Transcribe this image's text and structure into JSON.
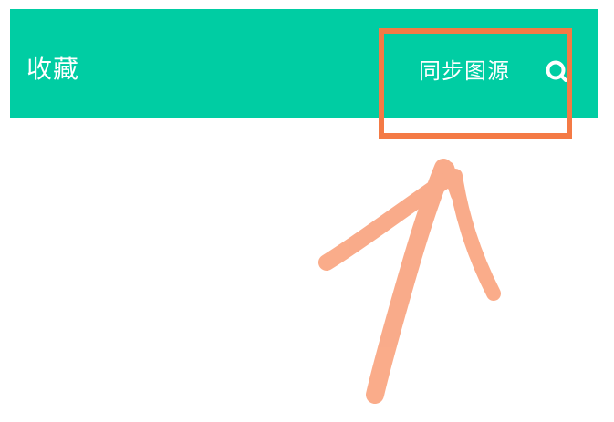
{
  "app_bar": {
    "title": "收藏",
    "sync_label": "同步图源",
    "search_icon": "search-icon",
    "background_color": "#00CDA3",
    "text_color": "#FFFFFF"
  },
  "annotation": {
    "box_color": "#F47A45",
    "arrow_color": "#F9A07A",
    "arrow_icon": "hand-drawn-arrow"
  }
}
